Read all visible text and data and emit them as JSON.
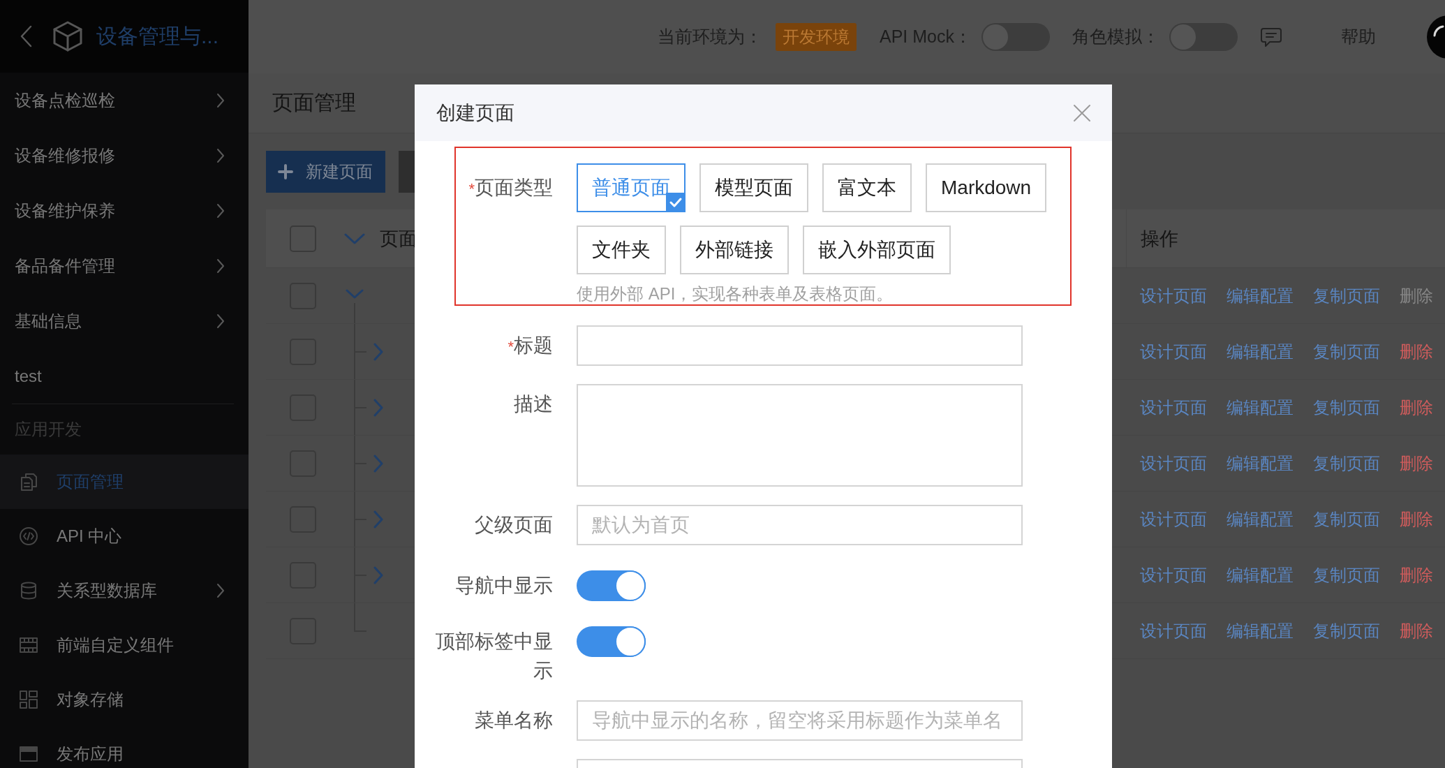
{
  "sidebar": {
    "title": "设备管理与...",
    "items": [
      {
        "label": "设备点检巡检",
        "expandable": true,
        "selected": false
      },
      {
        "label": "设备维修报修",
        "expandable": true,
        "selected": false
      },
      {
        "label": "设备维护保养",
        "expandable": true,
        "selected": false
      },
      {
        "label": "备品备件管理",
        "expandable": true,
        "selected": false
      },
      {
        "label": "基础信息",
        "expandable": true,
        "selected": false
      },
      {
        "label": "test",
        "expandable": false,
        "selected": false
      }
    ],
    "section": {
      "label": "应用开发",
      "items": [
        {
          "label": "页面管理",
          "expandable": false,
          "selected": true
        },
        {
          "label": "API 中心",
          "expandable": false,
          "selected": false
        },
        {
          "label": "关系型数据库",
          "expandable": true,
          "selected": false
        },
        {
          "label": "前端自定义组件",
          "expandable": false,
          "selected": false
        },
        {
          "label": "对象存储",
          "expandable": false,
          "selected": false
        },
        {
          "label": "发布应用",
          "expandable": false,
          "selected": false
        }
      ]
    }
  },
  "topbar": {
    "env_label": "当前环境为：",
    "env_badge": "开发环境",
    "toggles": [
      {
        "label": "API Mock：",
        "on": false
      },
      {
        "label": "角色模拟：",
        "on": false
      }
    ],
    "help": "帮助"
  },
  "page": {
    "title": "页面管理",
    "toolbar": [
      {
        "kind": "primary",
        "label": "新建页面"
      },
      {
        "kind": "secondary"
      }
    ]
  },
  "table": {
    "header": {
      "checked": false,
      "expanded": true
    },
    "columns": [
      {
        "label": "页面"
      },
      {
        "label": "操作"
      }
    ],
    "rows": [
      {
        "checked": false,
        "expandable": true,
        "expanded": true,
        "actions": [
          {
            "label": "设计页面",
            "kind": "link",
            "disabled": false
          },
          {
            "label": "编辑配置",
            "kind": "link",
            "disabled": false
          },
          {
            "label": "复制页面",
            "kind": "link",
            "disabled": false
          },
          {
            "label": "删除",
            "kind": "danger",
            "disabled": true
          }
        ],
        "children": [
          {
            "checked": false,
            "expandable": true,
            "expanded": false,
            "actions": [
              {
                "label": "设计页面",
                "kind": "link",
                "disabled": false
              },
              {
                "label": "编辑配置",
                "kind": "link",
                "disabled": false
              },
              {
                "label": "复制页面",
                "kind": "link",
                "disabled": false
              },
              {
                "label": "删除",
                "kind": "danger",
                "disabled": false
              }
            ]
          },
          {
            "checked": false,
            "expandable": true,
            "expanded": false,
            "actions": [
              {
                "label": "设计页面",
                "kind": "link",
                "disabled": false
              },
              {
                "label": "编辑配置",
                "kind": "link",
                "disabled": false
              },
              {
                "label": "复制页面",
                "kind": "link",
                "disabled": false
              },
              {
                "label": "删除",
                "kind": "danger",
                "disabled": false
              }
            ]
          },
          {
            "checked": false,
            "expandable": true,
            "expanded": false,
            "actions": [
              {
                "label": "设计页面",
                "kind": "link",
                "disabled": false
              },
              {
                "label": "编辑配置",
                "kind": "link",
                "disabled": false
              },
              {
                "label": "复制页面",
                "kind": "link",
                "disabled": false
              },
              {
                "label": "删除",
                "kind": "danger",
                "disabled": false
              }
            ]
          },
          {
            "checked": false,
            "expandable": true,
            "expanded": false,
            "actions": [
              {
                "label": "设计页面",
                "kind": "link",
                "disabled": false
              },
              {
                "label": "编辑配置",
                "kind": "link",
                "disabled": false
              },
              {
                "label": "复制页面",
                "kind": "link",
                "disabled": false
              },
              {
                "label": "删除",
                "kind": "danger",
                "disabled": false
              }
            ]
          },
          {
            "checked": false,
            "expandable": true,
            "expanded": false,
            "actions": [
              {
                "label": "设计页面",
                "kind": "link",
                "disabled": false
              },
              {
                "label": "编辑配置",
                "kind": "link",
                "disabled": false
              },
              {
                "label": "复制页面",
                "kind": "link",
                "disabled": false
              },
              {
                "label": "删除",
                "kind": "danger",
                "disabled": false
              }
            ]
          },
          {
            "checked": false,
            "expandable": false,
            "actions": [
              {
                "label": "设计页面",
                "kind": "link",
                "disabled": false
              },
              {
                "label": "编辑配置",
                "kind": "link",
                "disabled": false
              },
              {
                "label": "复制页面",
                "kind": "link",
                "disabled": false
              },
              {
                "label": "删除",
                "kind": "danger",
                "disabled": false
              }
            ]
          }
        ]
      }
    ]
  },
  "dialog": {
    "title": "创建页面",
    "fields": [
      {
        "kind": "choice",
        "required_mark": "*",
        "label": "页面类型",
        "highlighted": true,
        "options": [
          {
            "label": "普通页面",
            "selected": true
          },
          {
            "label": "模型页面",
            "selected": false
          },
          {
            "label": "富文本",
            "selected": false
          },
          {
            "label": "Markdown",
            "selected": false
          },
          {
            "label": "文件夹",
            "selected": false
          },
          {
            "label": "外部链接",
            "selected": false
          },
          {
            "label": "嵌入外部页面",
            "selected": false
          }
        ],
        "help": "使用外部 API，实现各种表单及表格页面。"
      },
      {
        "kind": "input",
        "required_mark": "*",
        "label": "标题"
      },
      {
        "kind": "textarea",
        "label": "描述"
      },
      {
        "kind": "input",
        "label": "父级页面",
        "placeholder": "默认为首页"
      },
      {
        "kind": "switch",
        "label": "导航中显示",
        "on": true
      },
      {
        "kind": "switch",
        "label": "顶部标签中显示",
        "on": true
      },
      {
        "kind": "input",
        "label": "菜单名称",
        "placeholder": "导航中显示的名称，留空将采用标题作为菜单名"
      },
      {
        "kind": "input"
      }
    ]
  }
}
